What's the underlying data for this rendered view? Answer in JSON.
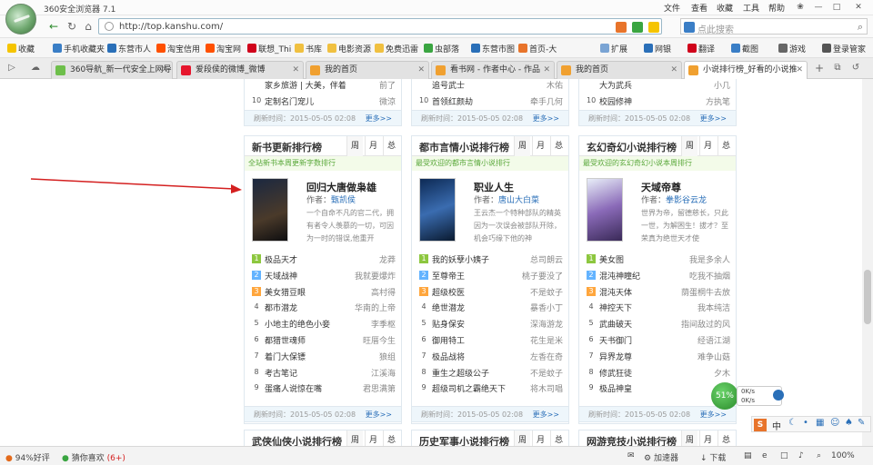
{
  "app": {
    "title": "360安全浏览器 7.1"
  },
  "menu": [
    "文件",
    "查看",
    "收藏",
    "工具",
    "帮助"
  ],
  "address": {
    "url": "http://top.kanshu.com/",
    "search_placeholder": "点此搜索"
  },
  "bookmarks": [
    "收藏",
    "手机收藏夹",
    "东营市人",
    "淘宝信用",
    "淘宝网",
    "联想_Thi",
    "书库",
    "电影资源",
    "免费迅雷",
    "虫部落",
    "东营市图",
    "首页-大",
    "扩展",
    "网银",
    "翻译",
    "截图",
    "游戏",
    "登录管家"
  ],
  "tabs": [
    {
      "label": "360导航_新一代安全上网导",
      "active": false
    },
    {
      "label": "爱段侯的微博_微博",
      "active": false
    },
    {
      "label": "我的首页",
      "active": false
    },
    {
      "label": "看书网 - 作者中心 - 作品",
      "active": false
    },
    {
      "label": "我的首页",
      "active": false
    },
    {
      "label": "小说排行榜_好看的小说推",
      "active": true
    }
  ],
  "top_partial": {
    "col1": [
      {
        "no": "",
        "title": "家乡旅游 | 大美，伴着",
        "author": "前了"
      },
      {
        "no": "10",
        "title": "定制名门宠儿",
        "author": "微涼"
      }
    ],
    "col2": [
      {
        "no": "",
        "title": "追号武士",
        "author": "木佑"
      },
      {
        "no": "10",
        "title": "首领红颜劫",
        "author": "牵手几何"
      }
    ],
    "col3": [
      {
        "no": "",
        "title": "大为武兵",
        "author": "小几"
      },
      {
        "no": "10",
        "title": "校园修神",
        "author": "方执笔"
      }
    ],
    "updated": "刷新时间：2015-05-05 02:08",
    "more": "更多>>"
  },
  "columns": [
    {
      "title": "新书更新排行榜",
      "tabs": [
        "周",
        "月",
        "总"
      ],
      "subtitle": "全站新书本周更新字数排行",
      "book": {
        "title": "回归大唐做枭雄",
        "author_label": "作者：",
        "author": "甄凯侯",
        "desc": "一个自命不凡的官二代，拥有者令人羡慕的一切，可因为一时的错误,他重开"
      },
      "list": [
        {
          "no": "1",
          "title": "极品天才",
          "author": "龙莽"
        },
        {
          "no": "2",
          "title": "天域战神",
          "author": "我就要爆炸"
        },
        {
          "no": "3",
          "title": "美女猎豆眼",
          "author": "高村得"
        },
        {
          "no": "4",
          "title": "都市潜龙",
          "author": "华南的上帝"
        },
        {
          "no": "5",
          "title": "小地主的绝色小妾",
          "author": "李季枢"
        },
        {
          "no": "6",
          "title": "都猎世魂师",
          "author": "旺厝今生"
        },
        {
          "no": "7",
          "title": "着门大保镖",
          "author": "狼组"
        },
        {
          "no": "8",
          "title": "考古笔记",
          "author": "江溪海"
        },
        {
          "no": "9",
          "title": "蛋痛人说惊在嘴",
          "author": "君思满第"
        },
        {
          "no": "10",
          "title": "",
          "author": ""
        }
      ],
      "updated": "刷新时间：2015-05-05 02:08",
      "more": "更多>>"
    },
    {
      "title": "都市言情小说排行榜",
      "tabs": [
        "周",
        "月",
        "总"
      ],
      "subtitle": "最受欢迎的都市言情小说排行",
      "book": {
        "title": "职业人生",
        "author_label": "作者：",
        "author": "唐山大白菜",
        "desc": "王云杰一个特种部队的精英因为一次误会被部队开除，机会巧缘下他的神"
      },
      "list": [
        {
          "no": "1",
          "title": "我的妖孽小姨子",
          "author": "总司朗云"
        },
        {
          "no": "2",
          "title": "至尊帝王",
          "author": "桃子要没了"
        },
        {
          "no": "3",
          "title": "超级校医",
          "author": "不是蚊子"
        },
        {
          "no": "4",
          "title": "绝世潜龙",
          "author": "暴香小丁"
        },
        {
          "no": "5",
          "title": "贴身保安",
          "author": "深海游龙"
        },
        {
          "no": "6",
          "title": "御用特工",
          "author": "花生是米"
        },
        {
          "no": "7",
          "title": "极品战将",
          "author": "左香在奇"
        },
        {
          "no": "8",
          "title": "重生之超级公子",
          "author": "不是蚊子"
        },
        {
          "no": "9",
          "title": "超级司机之霸绝天下",
          "author": "将木司唱"
        },
        {
          "no": "10",
          "title": "",
          "author": ""
        }
      ],
      "updated": "刷新时间：2015-05-05 02:08",
      "more": "更多>>"
    },
    {
      "title": "玄幻奇幻小说排行榜",
      "tabs": [
        "周",
        "月",
        "总"
      ],
      "subtitle": "最受欢迎的玄幻奇幻小说本周排行",
      "book": {
        "title": "天域帝尊",
        "author_label": "作者：",
        "author": "拳影谷云龙",
        "desc": "世界为帝，留德慈长，只此一世，为解困生！拔才？至荣真为绝世天才使"
      },
      "list": [
        {
          "no": "1",
          "title": "美女图",
          "author": "我是多余人"
        },
        {
          "no": "2",
          "title": "混沌神瞳纪",
          "author": "吃我不抽烟"
        },
        {
          "no": "3",
          "title": "混沌天体",
          "author": "荫蛋桐牛去放"
        },
        {
          "no": "4",
          "title": "神控天下",
          "author": "我本纯洁"
        },
        {
          "no": "5",
          "title": "武曲破天",
          "author": "指间敌过的风"
        },
        {
          "no": "6",
          "title": "天书御门",
          "author": "经语江湖"
        },
        {
          "no": "7",
          "title": "异界龙尊",
          "author": "难争山菇"
        },
        {
          "no": "8",
          "title": "修武狂徒",
          "author": "夕木"
        },
        {
          "no": "9",
          "title": "极品神皇",
          "author": ""
        },
        {
          "no": "10",
          "title": "",
          "author": ""
        }
      ],
      "updated": "刷新时间：2015-05-05 02:08",
      "more": "更多>>"
    }
  ],
  "bottom_headers": [
    {
      "title": "武侠仙侠小说排行榜",
      "tabs": [
        "周",
        "月",
        "总"
      ]
    },
    {
      "title": "历史军事小说排行榜",
      "tabs": [
        "周",
        "月",
        "总"
      ]
    },
    {
      "title": "网游竞技小说排行榜",
      "tabs": [
        "周",
        "月",
        "总"
      ]
    }
  ],
  "status": {
    "rating": "94%好评",
    "guess": "猜你喜欢",
    "guess_count": "(6+)",
    "accel": "加速器",
    "download": "下载",
    "zoom": "100%"
  },
  "speed_widget": {
    "percent": "51%",
    "up": "0K/s",
    "down": "0K/s"
  },
  "ime": {
    "label": "中"
  }
}
